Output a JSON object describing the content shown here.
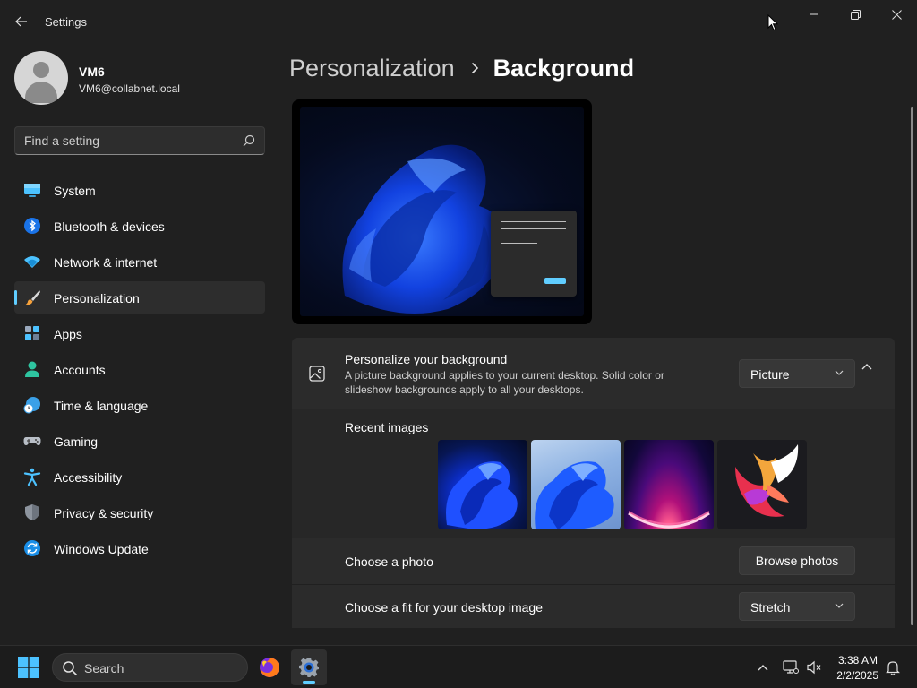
{
  "window": {
    "app_title": "Settings"
  },
  "profile": {
    "name": "VM6",
    "email": "VM6@collabnet.local"
  },
  "search": {
    "placeholder": "Find a setting"
  },
  "nav": {
    "items": [
      {
        "label": "System",
        "icon": "monitor-icon"
      },
      {
        "label": "Bluetooth & devices",
        "icon": "bluetooth-icon"
      },
      {
        "label": "Network & internet",
        "icon": "wifi-icon"
      },
      {
        "label": "Personalization",
        "icon": "paintbrush-icon",
        "selected": true
      },
      {
        "label": "Apps",
        "icon": "apps-icon"
      },
      {
        "label": "Accounts",
        "icon": "person-icon"
      },
      {
        "label": "Time & language",
        "icon": "globe-clock-icon"
      },
      {
        "label": "Gaming",
        "icon": "gamepad-icon"
      },
      {
        "label": "Accessibility",
        "icon": "accessibility-icon"
      },
      {
        "label": "Privacy & security",
        "icon": "shield-icon"
      },
      {
        "label": "Windows Update",
        "icon": "sync-icon"
      }
    ]
  },
  "breadcrumb": {
    "parent": "Personalization",
    "current": "Background"
  },
  "background": {
    "title": "Personalize your background",
    "description": "A picture background applies to your current desktop. Solid color or slideshow backgrounds apply to all your desktops.",
    "type_value": "Picture"
  },
  "recent": {
    "label": "Recent images",
    "images": [
      {
        "name": "bloom-dark-blue"
      },
      {
        "name": "bloom-light-blue"
      },
      {
        "name": "glow-purple-arc"
      },
      {
        "name": "colorful-ribbon"
      }
    ]
  },
  "choose_photo": {
    "label": "Choose a photo",
    "button": "Browse photos"
  },
  "fit": {
    "label": "Choose a fit for your desktop image",
    "value": "Stretch"
  },
  "taskbar": {
    "search_label": "Search",
    "time": "3:38 AM",
    "date": "2/2/2025"
  },
  "colors": {
    "accent": "#60cdff",
    "background": "#202020",
    "card": "#2b2b2b"
  }
}
